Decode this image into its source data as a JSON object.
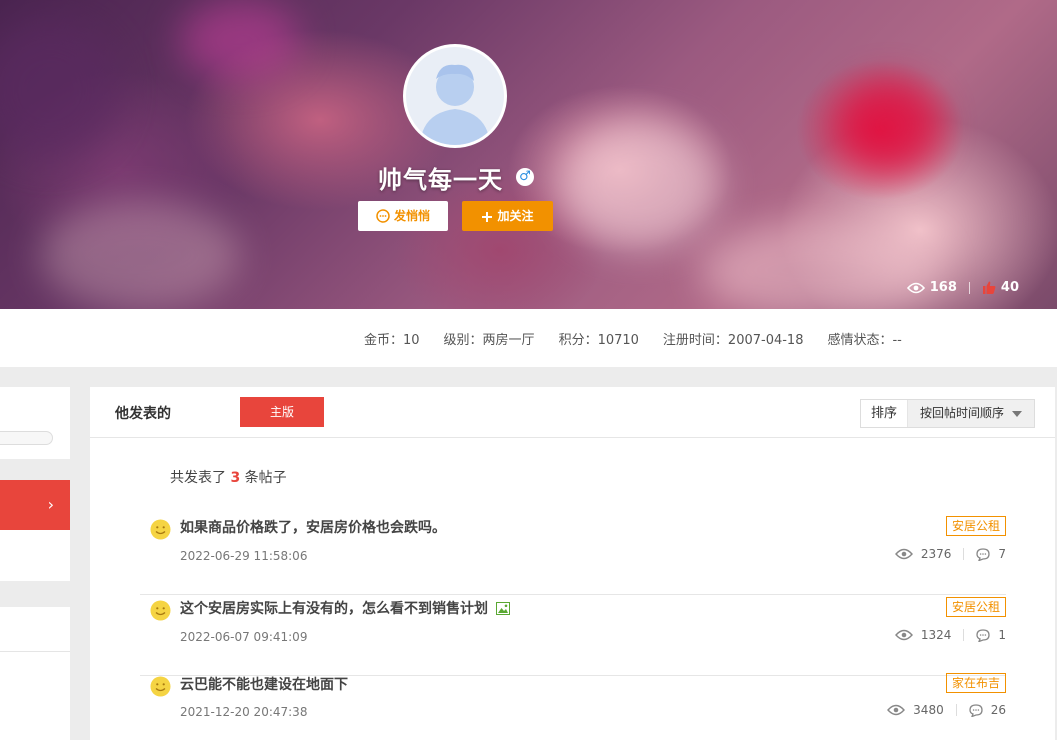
{
  "profile": {
    "username": "帅气每一天",
    "gender_icon": "male-icon",
    "gender_symbol": "♂",
    "message_button": "发悄悄",
    "follow_button": "加关注",
    "views": "168",
    "likes": "40"
  },
  "info": {
    "coins": "金币：10",
    "level": "级别：两房一厅",
    "points": "积分：10710",
    "registered": "注册时间：2007-04-18",
    "relationship": "感情状态：--"
  },
  "main": {
    "title": "他发表的",
    "tab": "主版",
    "sort_label": "排序",
    "sort_value": "按回帖时间顺序",
    "total_prefix": "共发表了",
    "total_count": "3",
    "total_suffix": "条帖子"
  },
  "posts": [
    {
      "title": "如果商品价格跌了，安居房价格也会跌吗。",
      "date": "2022-06-29 11:58:06",
      "tag": "安居公租",
      "views": "2376",
      "replies": "7",
      "has_image": false
    },
    {
      "title": "这个安居房实际上有没有的，怎么看不到销售计划",
      "date": "2022-06-07 09:41:09",
      "tag": "安居公租",
      "views": "1324",
      "replies": "1",
      "has_image": true
    },
    {
      "title": "云巴能不能也建设在地面下",
      "date": "2021-12-20 20:47:38",
      "tag": "家在布吉",
      "views": "3480",
      "replies": "26",
      "has_image": false
    }
  ],
  "colors": {
    "accent_red": "#e8453c",
    "accent_orange": "#f29100"
  }
}
